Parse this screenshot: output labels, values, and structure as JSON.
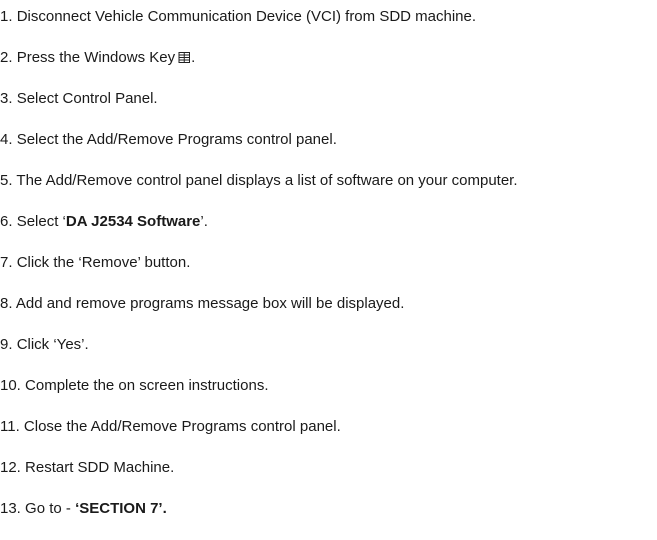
{
  "steps": [
    {
      "number": "1.",
      "text": "Disconnect Vehicle Communication Device (VCI) from SDD machine."
    },
    {
      "number": "2.",
      "pre": "Press the Windows Key",
      "icon": "windows-key-icon",
      "post": "."
    },
    {
      "number": "3.",
      "text": "Select Control Panel."
    },
    {
      "number": "4.",
      "text": "Select the Add/Remove Programs control panel."
    },
    {
      "number": "5.",
      "text": "The Add/Remove control panel displays a list of software on your computer."
    },
    {
      "number": "6.",
      "pre": "Select ‘",
      "bold": "DA J2534 Software",
      "post": "’."
    },
    {
      "number": "7.",
      "text": "Click the ‘Remove’ button."
    },
    {
      "number": "8.",
      "text": "Add and remove programs message box will be displayed."
    },
    {
      "number": "9.",
      "text": "Click ‘Yes’."
    },
    {
      "number": "10.",
      "text": "Complete the on screen instructions."
    },
    {
      "number": "11.",
      "text": "Close the Add/Remove Programs control panel."
    },
    {
      "number": "12.",
      "text": "Restart SDD Machine."
    },
    {
      "number": "13.",
      "pre": "Go to - ",
      "bold": "‘SECTION 7’."
    }
  ]
}
